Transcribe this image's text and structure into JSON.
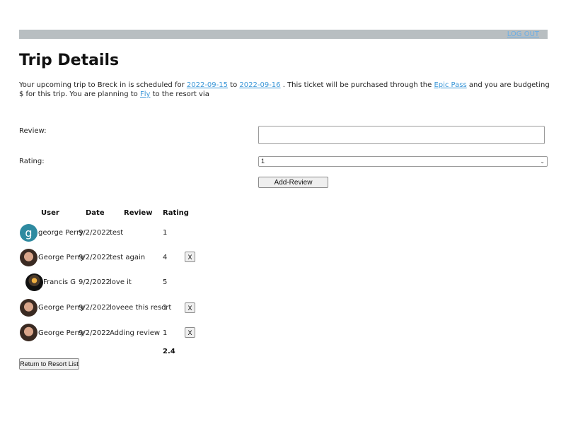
{
  "header": {
    "logout_label": "LOG OUT"
  },
  "page": {
    "title": "Trip Details"
  },
  "summary": {
    "part1": "Your upcoming trip to Breck in is scheduled for ",
    "start_date": "2022-09-15",
    "part2": " to ",
    "end_date": "2022-09-16",
    "part3": " . This ticket will be purchased through the ",
    "pass": "Epic Pass",
    "part4": " and you are budgeting $ for this trip. You are planning to ",
    "travel_mode": "Fly",
    "part5": " to the resort via"
  },
  "form": {
    "review_label": "Review:",
    "review_value": "",
    "rating_label": "Rating:",
    "rating_value": "1",
    "add_button": "Add-Review"
  },
  "reviews_table": {
    "headers": {
      "user": "User",
      "date": "Date",
      "review": "Review",
      "rating": "Rating"
    },
    "rows": [
      {
        "avatar": "letter",
        "avatar_letter": "g",
        "user": "george Perry",
        "date": "9/2/2022",
        "review": "test",
        "rating": "1",
        "delete_label": ""
      },
      {
        "avatar": "photo",
        "avatar_letter": "",
        "user": "George Perry",
        "date": "9/2/2022",
        "review": "test again",
        "rating": "4",
        "delete_label": "X"
      },
      {
        "avatar": "dark",
        "avatar_letter": "",
        "user": "Francis G",
        "date": "9/2/2022",
        "review": "love it",
        "rating": "5",
        "delete_label": ""
      },
      {
        "avatar": "photo",
        "avatar_letter": "",
        "user": "George Perry",
        "date": "9/2/2022",
        "review": "loveee this resort",
        "rating": "1",
        "delete_label": "X"
      },
      {
        "avatar": "photo",
        "avatar_letter": "",
        "user": "George Perry",
        "date": "9/2/2022",
        "review": "Adding review",
        "rating": "1",
        "delete_label": "X"
      }
    ],
    "average_rating": "2.4"
  },
  "footer": {
    "return_button": "Return to Resort List"
  },
  "colors": {
    "link": "#3b97d8",
    "topbar": "#b8bec1",
    "avatar_letter_bg": "#2e8aa0"
  }
}
